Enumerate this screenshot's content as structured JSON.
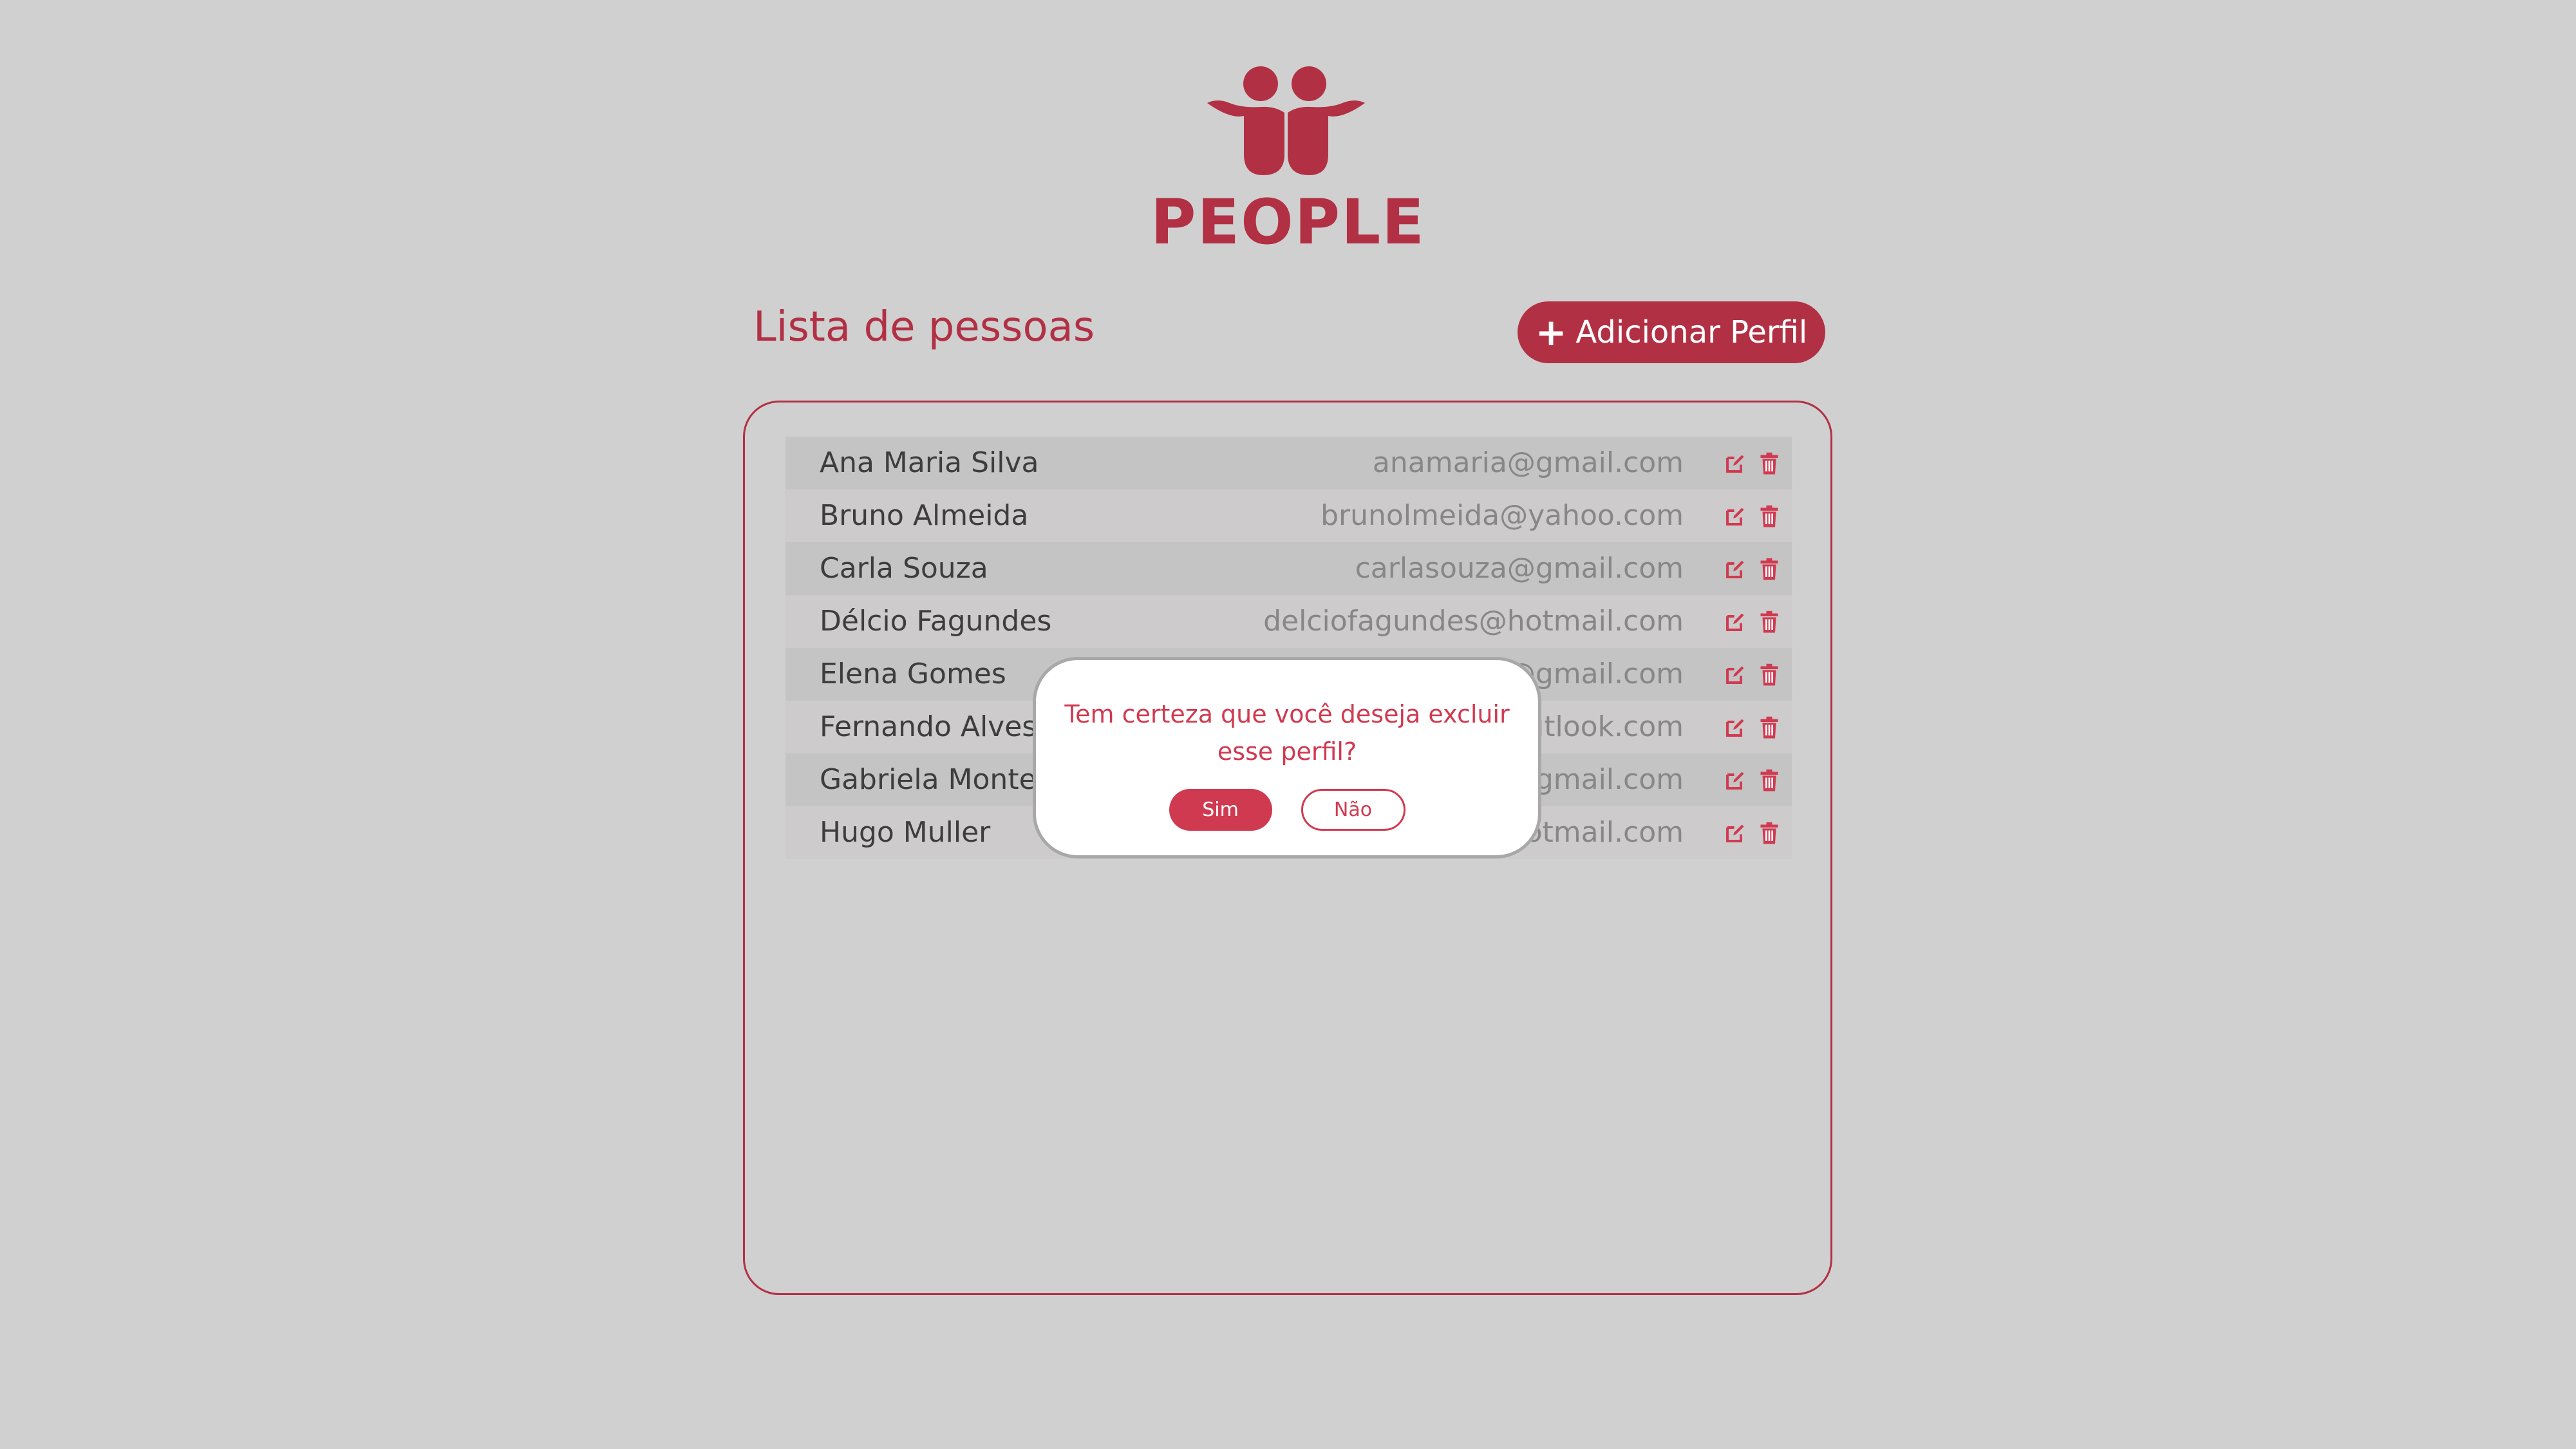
{
  "app": {
    "brand": "PEOPLE",
    "logo_icon": "people-hug-icon",
    "accent_color": "#b23044"
  },
  "header": {
    "list_title": "Lista de pessoas",
    "add_button": {
      "icon": "plus-icon",
      "label": "Adicionar Perfil"
    }
  },
  "people": [
    {
      "name": "Ana Maria Silva",
      "email": "anamaria@gmail.com"
    },
    {
      "name": "Bruno Almeida",
      "email": "brunolmeida@yahoo.com"
    },
    {
      "name": "Carla Souza",
      "email": "carlasouza@gmail.com"
    },
    {
      "name": "Délcio Fagundes",
      "email": "delciofagundes@hotmail.com"
    },
    {
      "name": "Elena Gomes",
      "email": "elenagomes@gmail.com"
    },
    {
      "name": "Fernando Alves",
      "email": "fernandoalves@outlook.com"
    },
    {
      "name": "Gabriela Montez",
      "email": "gabrielamontez@gmail.com"
    },
    {
      "name": "Hugo Muller",
      "email": "hugomuller@hotmail.com"
    }
  ],
  "row_icons": {
    "edit": "edit-icon",
    "delete": "trash-icon"
  },
  "modal": {
    "message": "Tem certeza que você deseja excluir esse perfil?",
    "confirm_label": "Sim",
    "cancel_label": "Não"
  }
}
